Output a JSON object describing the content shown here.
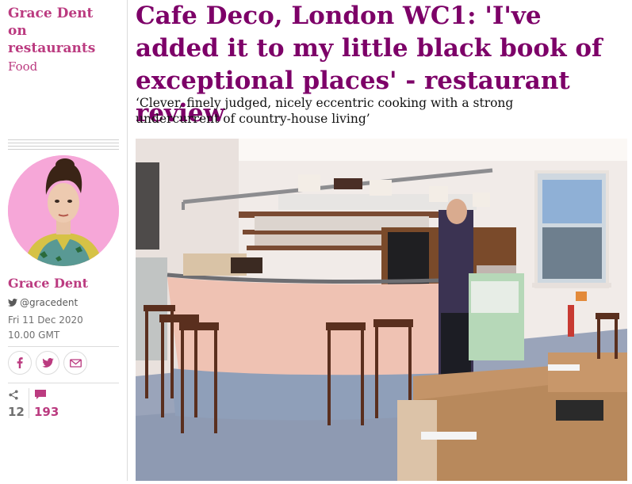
{
  "series": {
    "title": "Grace Dent on restaurants",
    "title_lines": [
      "Grace Dent",
      "on",
      "restaurants"
    ],
    "section": "Food"
  },
  "article": {
    "headline": "Cafe Deco, London WC1: 'I've added it to my little black book of exceptional places' - restaurant review",
    "standfirst": "‘Clever, finely judged, nicely eccentric cooking with a strong undercurrent of country-house living’"
  },
  "byline": {
    "name": "Grace Dent",
    "twitter": "@gracedent",
    "date": "Fri 11 Dec 2020 10.00 GMT"
  },
  "share": {
    "count": "12"
  },
  "comments": {
    "count": "193"
  },
  "colors": {
    "accent": "#bb3b80",
    "headline": "#7d0068",
    "comment": "#bb3b80"
  },
  "icons": [
    "twitter-bird-icon",
    "facebook-icon",
    "twitter-icon",
    "email-icon",
    "share-icon",
    "comment-icon"
  ]
}
